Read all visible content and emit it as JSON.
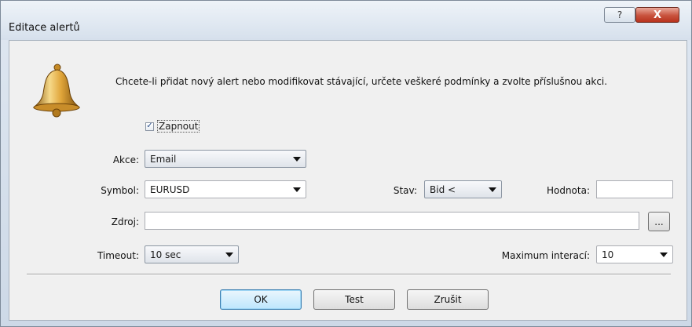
{
  "window": {
    "title": "Editace alertů",
    "help_label": "?",
    "close_label": "X"
  },
  "info_text": "Chcete-li přidat nový alert nebo modifikovat stávající, určete veškeré podmínky a zvolte příslušnou akci.",
  "enable": {
    "label": "Zapnout",
    "checked": true,
    "mark": "✓"
  },
  "fields": {
    "action": {
      "label": "Akce:",
      "value": "Email"
    },
    "symbol": {
      "label": "Symbol:",
      "value": "EURUSD"
    },
    "state": {
      "label": "Stav:",
      "value": "Bid <"
    },
    "value": {
      "label": "Hodnota:",
      "value": ""
    },
    "source": {
      "label": "Zdroj:",
      "value": "",
      "browse_label": "..."
    },
    "timeout": {
      "label": "Timeout:",
      "value": "10 sec"
    },
    "max_iterations": {
      "label": "Maximum interací:",
      "value": "10"
    }
  },
  "buttons": {
    "ok": "OK",
    "test": "Test",
    "cancel": "Zrušit"
  },
  "icons": {
    "bell": "bell-icon"
  }
}
